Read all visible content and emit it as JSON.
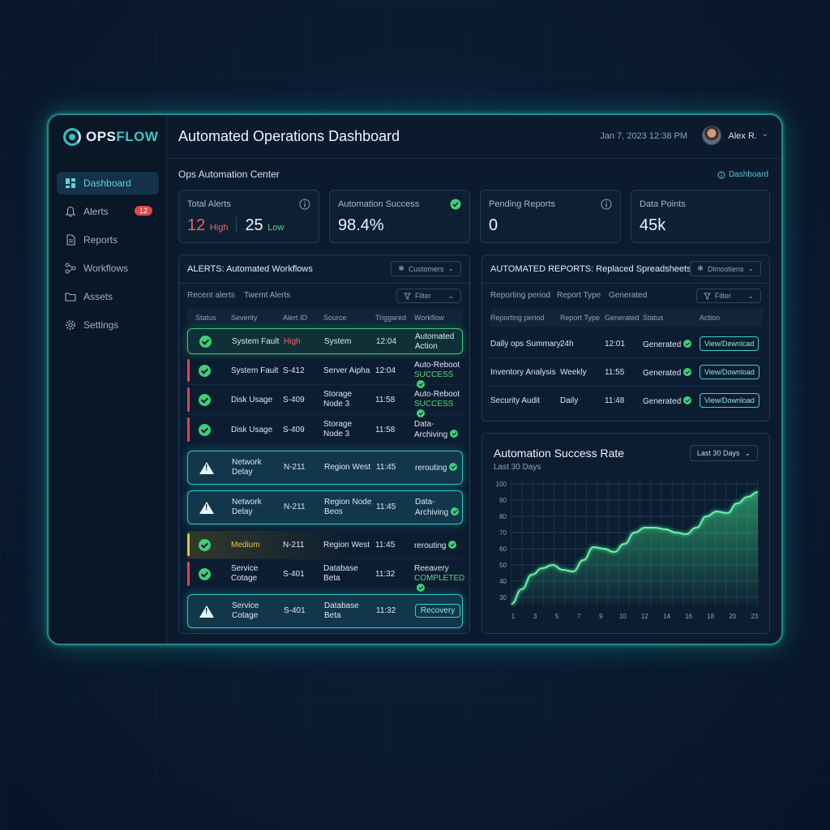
{
  "app": {
    "logo_part1": "OPS",
    "logo_part2": "FLOW",
    "title": "Automated Operations Dashboard",
    "datetime": "Jan 7, 2023 12:38 PM",
    "user": "Alex R."
  },
  "sidebar": {
    "items": [
      {
        "label": "Dashboard",
        "icon": "dashboard-icon",
        "active": true
      },
      {
        "label": "Alerts",
        "icon": "bell-icon",
        "badge": "12"
      },
      {
        "label": "Reports",
        "icon": "document-icon"
      },
      {
        "label": "Workflows",
        "icon": "workflow-icon"
      },
      {
        "label": "Assets",
        "icon": "folder-icon"
      },
      {
        "label": "Settings",
        "icon": "gear-icon"
      }
    ]
  },
  "main": {
    "section_title": "Ops Automation Center",
    "section_link": "Dashboard"
  },
  "kpis": {
    "total_alerts": {
      "label": "Total Alerts",
      "high_value": "12",
      "high_label": "High",
      "low_value": "25",
      "low_label": "Low"
    },
    "automation_success": {
      "label": "Automation Success",
      "value": "98.4%"
    },
    "pending_reports": {
      "label": "Pending Reports",
      "value": "0"
    },
    "data_points": {
      "label": "Data Points",
      "value": "45k"
    }
  },
  "alerts_panel": {
    "title": "ALERTS: Automated Workflows",
    "dropdown": "Customers",
    "tab_recent": "Recent alerts",
    "tab_other": "Twemt Alerts",
    "filter": "Filter",
    "columns": [
      "Status",
      "Severity",
      "Alert ID",
      "Source",
      "Triggared",
      "Workflow"
    ],
    "rows": [
      {
        "severity": "System Fault",
        "severity2": "",
        "id": "High",
        "source": "System",
        "source2": "",
        "time": "12:04",
        "wf1": "Automated",
        "wf2": "Action"
      },
      {
        "severity": "System Fault",
        "severity2": "",
        "id": "S-412",
        "source": "Server Aipha",
        "source2": "",
        "time": "12:04",
        "wf1": "Auto-Reboot",
        "wf2": "SUCCESS"
      },
      {
        "severity": "Disk Usage",
        "severity2": "",
        "id": "S-409",
        "source": "Storage",
        "source2": "Node 3",
        "time": "11:58",
        "wf1": "Auto-Reboot",
        "wf2": "SUCCESS"
      },
      {
        "severity": "Disk Usage",
        "severity2": "",
        "id": "S-409",
        "source": "Storage",
        "source2": "Node 3",
        "time": "11:58",
        "wf1": "Data-",
        "wf2": "Archiving"
      },
      {
        "severity": "Network",
        "severity2": "Delay",
        "id": "N-211",
        "source": "Region West",
        "source2": "",
        "time": "11:45",
        "wf1": "rerouting",
        "wf2": ""
      },
      {
        "severity": "Network",
        "severity2": "Delay",
        "id": "N-211",
        "source": "Region Node",
        "source2": "Beos",
        "time": "11:45",
        "wf1": "Data-",
        "wf2": "Archiving"
      },
      {
        "severity": "Medium",
        "severity2": "",
        "id": "N-211",
        "source": "Region West",
        "source2": "",
        "time": "11:45",
        "wf1": "rerouting",
        "wf2": ""
      },
      {
        "severity": "Service",
        "severity2": "Cotage",
        "id": "S-401",
        "source": "Database",
        "source2": "Beta",
        "time": "11:32",
        "wf1": "Reeavery",
        "wf2": "COMPLETED"
      },
      {
        "severity": "Service",
        "severity2": "Cotage",
        "id": "S-401",
        "source": "Database",
        "source2": "Beta",
        "time": "11:32",
        "wf1": "Recovery",
        "wf2": ""
      }
    ]
  },
  "reports_panel": {
    "title": "AUTOMATED REPORTS: Replaced Spreadsheets",
    "dropdown": "Dlmostiens",
    "tab1": "Reporting period",
    "tab2": "Report Type",
    "tab3": "Generated",
    "filter": "Filter",
    "columns": [
      "Reporting period",
      "Report Type",
      "Generated",
      "Status",
      "Action"
    ],
    "rows": [
      {
        "name": "Dally ops Summary",
        "type": "24h",
        "time": "12:01",
        "status": "Generated",
        "action": "View/Dewnlcad"
      },
      {
        "name": "Inventory Analysis",
        "type": "Weekly",
        "time": "11:55",
        "status": "Generated",
        "action": "View/Download"
      },
      {
        "name": "Security Audit",
        "type": "Daily",
        "time": "11:48",
        "status": "Generated",
        "action": "View/Download"
      }
    ]
  },
  "chart_data": {
    "type": "area",
    "title": "Automation Success Rate",
    "subtitle": "Last 30 Days",
    "range_label": "Last 30 Days",
    "x_ticks": [
      "1",
      "3",
      "5",
      "7",
      "9",
      "10",
      "12",
      "14",
      "16",
      "18",
      "20",
      "23"
    ],
    "y_ticks": [
      100,
      90,
      80,
      70,
      60,
      50,
      40,
      30
    ],
    "ylim": [
      25,
      100
    ],
    "x": [
      0,
      1,
      2,
      3,
      4,
      5,
      6,
      7,
      8,
      9,
      10,
      11,
      12,
      13,
      14,
      15,
      16,
      17,
      18,
      19,
      20,
      21,
      22,
      23
    ],
    "values": [
      26,
      35,
      44,
      48,
      50,
      47,
      46,
      53,
      61,
      60,
      58,
      63,
      70,
      73,
      73,
      72,
      70,
      69,
      73,
      80,
      83,
      82,
      88,
      92,
      95
    ],
    "color": "#3ee08a"
  }
}
